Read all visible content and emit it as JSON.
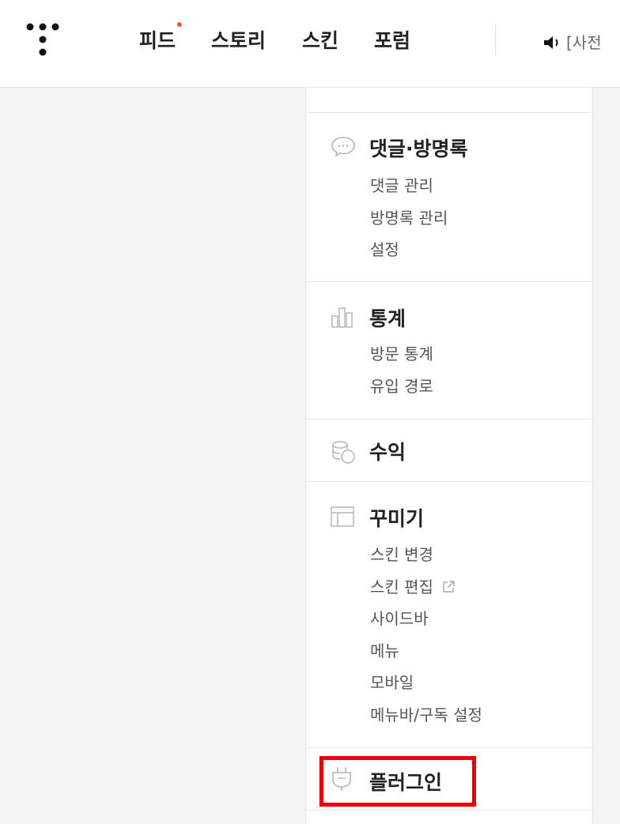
{
  "topbar": {
    "nav": [
      {
        "label": "피드",
        "has_new_dot": true
      },
      {
        "label": "스토리"
      },
      {
        "label": "스킨"
      },
      {
        "label": "포럼"
      }
    ],
    "notice_text": "[사전",
    "new_dot_color": "#f2543e"
  },
  "sidebar": {
    "sections": [
      {
        "title": "댓글·방명록",
        "icon": "speech-bubble-icon",
        "items": [
          "댓글 관리",
          "방명록 관리",
          "설정"
        ]
      },
      {
        "title": "통계",
        "icon": "bar-chart-icon",
        "items": [
          "방문 통계",
          "유입 경로"
        ]
      },
      {
        "title": "수익",
        "icon": "coins-icon",
        "items": []
      },
      {
        "title": "꾸미기",
        "icon": "layout-icon",
        "items": [
          "스킨 변경",
          "스킨 편집",
          "사이드바",
          "메뉴",
          "모바일",
          "메뉴바/구독 설정"
        ]
      },
      {
        "title": "플러그인",
        "icon": "plug-icon",
        "items": []
      }
    ]
  },
  "colors": {
    "highlight_border": "#ee0000",
    "background": "#f3f3f3"
  }
}
